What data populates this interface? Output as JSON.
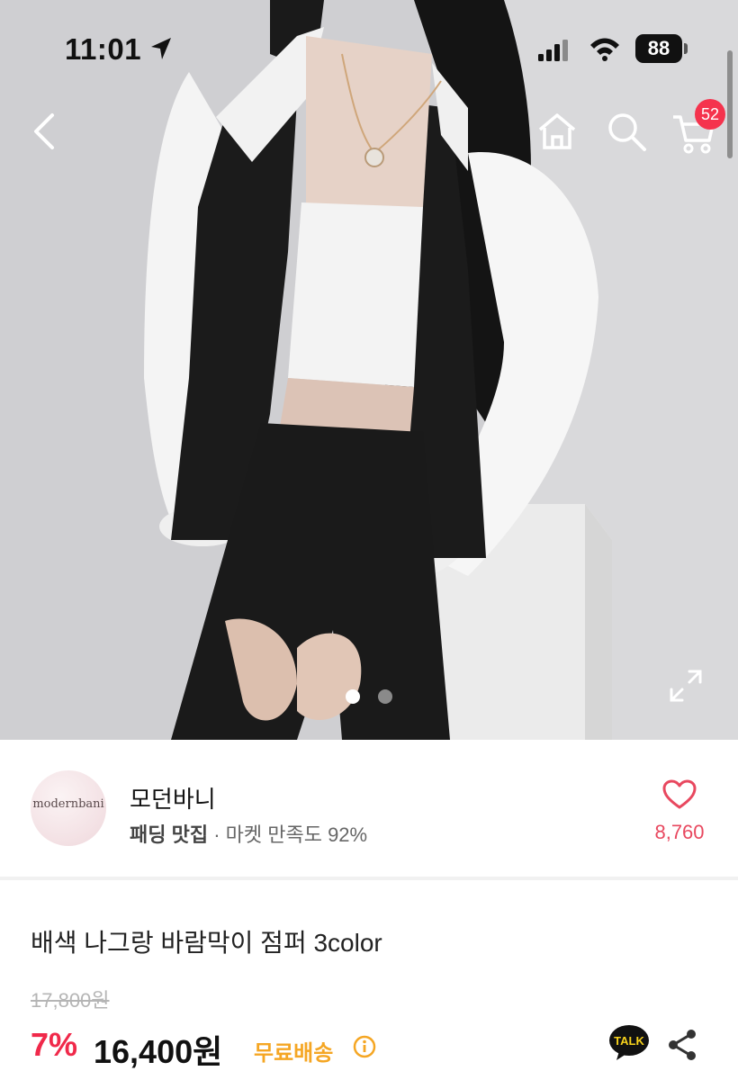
{
  "status_bar": {
    "time": "11:01",
    "battery": "88"
  },
  "nav": {
    "cart_badge": "52",
    "icons": [
      "back-chevron-icon",
      "home-icon",
      "search-icon",
      "cart-icon"
    ]
  },
  "gallery": {
    "page_count": 2,
    "current_page": 1,
    "expand_icon": "expand-icon"
  },
  "shop": {
    "logo_text": "modernbani",
    "name": "모던바니",
    "tag": "패딩 맛집",
    "satisfaction": "· 마켓 만족도 92%",
    "like_count": "8,760"
  },
  "product": {
    "title": "배색 나그랑 바람막이 점퍼 3color",
    "original_price": "17,800원",
    "discount": "7%",
    "price": "16,400원",
    "shipping": "무료배송",
    "talk_label": "TALK"
  },
  "colors": {
    "accent": "#f0294a",
    "badge": "#f5334d",
    "shipping": "#f5a623",
    "like": "#e8485f"
  }
}
